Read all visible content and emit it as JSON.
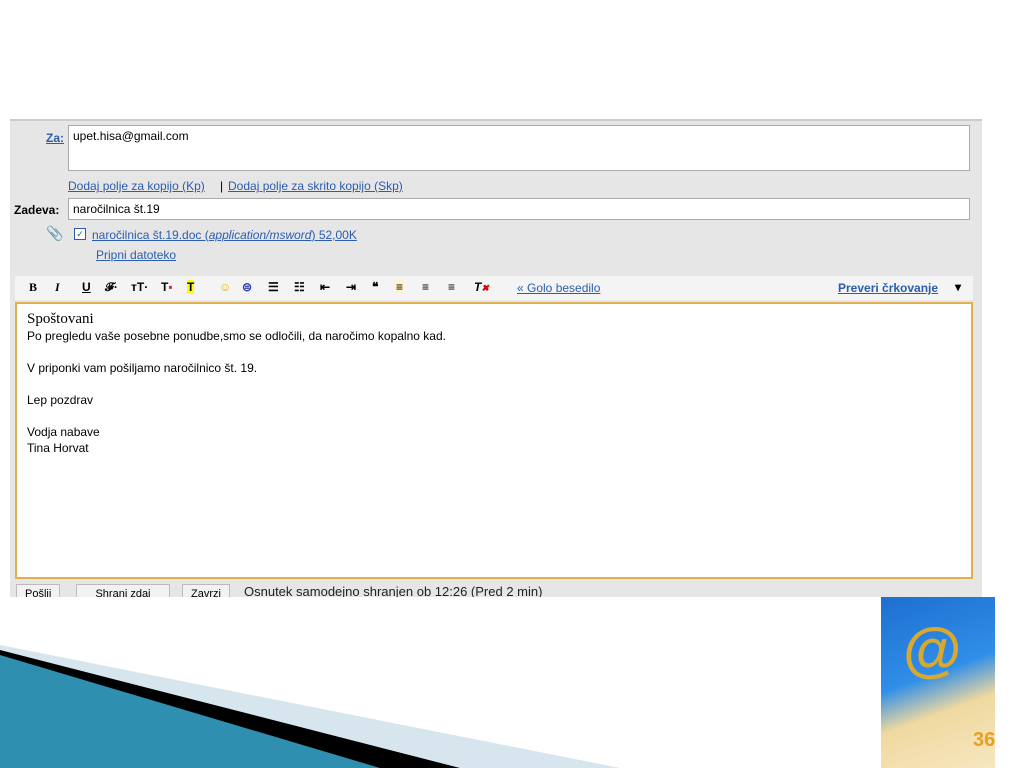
{
  "compose": {
    "to_label": "Za:",
    "to_value": "upet.hisa@gmail.com",
    "add_cc": "Dodaj polje za kopijo (Kp)",
    "separator": "|",
    "add_bcc": "Dodaj polje za skrito kopijo (Skp)",
    "subject_label": "Zadeva:",
    "subject_value": "naročilnica št.19",
    "attachment_name": "naročilnica št.19.doc",
    "attachment_type": "application/msword",
    "attachment_size": "52,00K",
    "attach_file": "Pripni datoteko"
  },
  "toolbar": {
    "bold": "B",
    "italic": "I",
    "underline": "U",
    "font": "𝓕·",
    "size": "тT·",
    "plain_text": "« Golo besedilo",
    "spellcheck": "Preveri črkovanje",
    "spellcheck_arrow": "▾"
  },
  "body": {
    "greeting": "Spoštovani",
    "line1": "Po pregledu vaše posebne ponudbe,smo se odločili, da naročimo kopalno kad.",
    "line2": "V priponki vam pošiljamo naročilnico št. 19.",
    "line3": "Lep pozdrav",
    "line4": "Vodja nabave",
    "line5": "Tina Horvat"
  },
  "footer": {
    "send": "Pošlji",
    "save": "Shrani zdaj",
    "discard": "Zavrzi",
    "status": "Osnutek samodejno shranjen ob 12:26 (Pred 2 min)"
  },
  "slide": {
    "page_number": "36",
    "accent": "#e8a020"
  }
}
